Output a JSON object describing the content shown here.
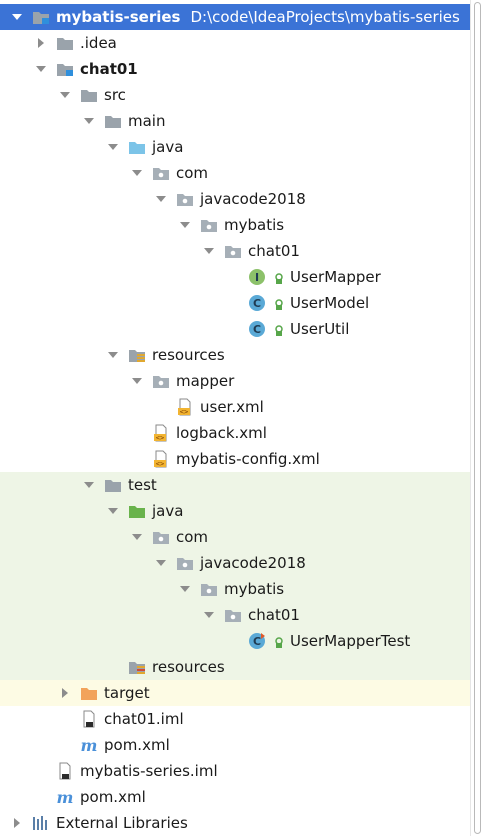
{
  "project": {
    "root_name": "mybatis-series",
    "root_path": "D:\\code\\IdeaProjects\\mybatis-series"
  },
  "tree": [
    {
      "name": "mybatis-series-root",
      "label": "mybatis-series",
      "icon": "module-folder-icon",
      "arrow": "expanded",
      "depth": 0
    },
    {
      "name": "idea-folder",
      "label": ".idea",
      "icon": "folder-icon",
      "arrow": "collapsed",
      "depth": 1
    },
    {
      "name": "chat01-module",
      "label": "chat01",
      "icon": "module-folder-icon",
      "arrow": "expanded",
      "depth": 1
    },
    {
      "name": "src-folder",
      "label": "src",
      "icon": "folder-icon",
      "arrow": "expanded",
      "depth": 2
    },
    {
      "name": "main-folder",
      "label": "main",
      "icon": "folder-icon",
      "arrow": "expanded",
      "depth": 3
    },
    {
      "name": "java-source-folder",
      "label": "java",
      "icon": "source-folder-icon",
      "arrow": "expanded",
      "depth": 4
    },
    {
      "name": "com-package",
      "label": "com",
      "icon": "package-icon",
      "arrow": "expanded",
      "depth": 5
    },
    {
      "name": "javacode2018-package",
      "label": "javacode2018",
      "icon": "package-icon",
      "arrow": "expanded",
      "depth": 6
    },
    {
      "name": "mybatis-package",
      "label": "mybatis",
      "icon": "package-icon",
      "arrow": "expanded",
      "depth": 7
    },
    {
      "name": "chat01-package",
      "label": "chat01",
      "icon": "package-icon",
      "arrow": "expanded",
      "depth": 8
    },
    {
      "name": "usermapper-file",
      "label": "UserMapper",
      "icon": "interface-icon",
      "arrow": "none",
      "depth": 9
    },
    {
      "name": "usermodel-file",
      "label": "UserModel",
      "icon": "class-icon",
      "arrow": "none",
      "depth": 9
    },
    {
      "name": "userutil-file",
      "label": "UserUtil",
      "icon": "class-icon",
      "arrow": "none",
      "depth": 9
    },
    {
      "name": "resources-folder",
      "label": "resources",
      "icon": "resources-folder-icon",
      "arrow": "expanded",
      "depth": 4
    },
    {
      "name": "mapper-folder",
      "label": "mapper",
      "icon": "package-icon",
      "arrow": "expanded",
      "depth": 5
    },
    {
      "name": "user-xml-file",
      "label": "user.xml",
      "icon": "xml-file-icon",
      "arrow": "none",
      "depth": 6
    },
    {
      "name": "logback-xml-file",
      "label": "logback.xml",
      "icon": "xml-file-icon",
      "arrow": "none",
      "depth": 5
    },
    {
      "name": "mybatis-config-xml-file",
      "label": "mybatis-config.xml",
      "icon": "xml-file-icon",
      "arrow": "none",
      "depth": 5
    },
    {
      "name": "test-folder",
      "label": "test",
      "icon": "folder-icon",
      "arrow": "expanded",
      "depth": 3
    },
    {
      "name": "test-java-folder",
      "label": "java",
      "icon": "test-source-folder-icon",
      "arrow": "expanded",
      "depth": 4
    },
    {
      "name": "test-com-package",
      "label": "com",
      "icon": "package-icon",
      "arrow": "expanded",
      "depth": 5
    },
    {
      "name": "test-javacode2018-package",
      "label": "javacode2018",
      "icon": "package-icon",
      "arrow": "expanded",
      "depth": 6
    },
    {
      "name": "test-mybatis-package",
      "label": "mybatis",
      "icon": "package-icon",
      "arrow": "expanded",
      "depth": 7
    },
    {
      "name": "test-chat01-package",
      "label": "chat01",
      "icon": "package-icon",
      "arrow": "expanded",
      "depth": 8
    },
    {
      "name": "usermappertest-file",
      "label": "UserMapperTest",
      "icon": "test-class-icon",
      "arrow": "none",
      "depth": 9
    },
    {
      "name": "test-resources-folder",
      "label": "resources",
      "icon": "test-resources-folder-icon",
      "arrow": "none",
      "depth": 4
    },
    {
      "name": "target-folder",
      "label": "target",
      "icon": "excluded-folder-icon",
      "arrow": "collapsed",
      "depth": 2
    },
    {
      "name": "chat01-iml-file",
      "label": "chat01.iml",
      "icon": "iml-file-icon",
      "arrow": "none",
      "depth": 2
    },
    {
      "name": "chat01-pom-file",
      "label": "pom.xml",
      "icon": "maven-icon",
      "arrow": "none",
      "depth": 2
    },
    {
      "name": "mybatis-series-iml-file",
      "label": "mybatis-series.iml",
      "icon": "iml-file-icon",
      "arrow": "none",
      "depth": 1
    },
    {
      "name": "root-pom-file",
      "label": "pom.xml",
      "icon": "maven-icon",
      "arrow": "none",
      "depth": 1
    },
    {
      "name": "external-libraries",
      "label": "External Libraries",
      "icon": "libraries-icon",
      "arrow": "collapsed",
      "depth": 0
    }
  ],
  "colors": {
    "selection": "#3b73d6",
    "test_background": "#eef5e6",
    "target_background": "#fdfbe4",
    "folder_gray": "#9aa3ab",
    "source_blue": "#7cc4e8",
    "test_green": "#69b34c",
    "excluded_orange": "#f2a35b",
    "class_blue": "#5aa9d6",
    "interface_green": "#8cc16a"
  }
}
